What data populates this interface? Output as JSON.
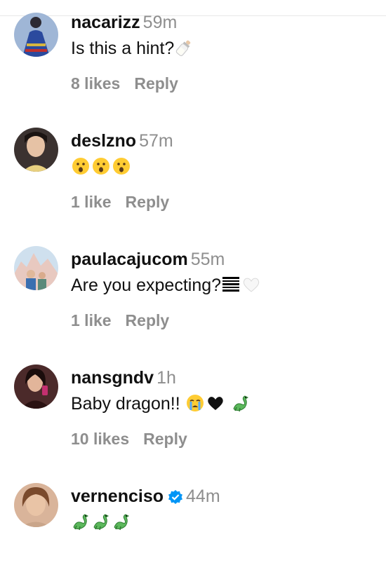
{
  "comments": [
    {
      "username": "nacarizz",
      "time": "59m",
      "text": "Is this a hint?",
      "text_emoji": [
        "baby-bottle"
      ],
      "likes": "8 likes",
      "reply": "Reply",
      "verified": false
    },
    {
      "username": "deslzno",
      "time": "57m",
      "text": "",
      "text_emoji": [
        "astonished-face",
        "astonished-face",
        "astonished-face"
      ],
      "likes": "1 like",
      "reply": "Reply",
      "verified": false
    },
    {
      "username": "paulacajucom",
      "time": "55m",
      "text": "Are you expecting?",
      "text_emoji": [
        "barcode",
        "white-heart"
      ],
      "likes": "1 like",
      "reply": "Reply",
      "verified": false
    },
    {
      "username": "nansgndv",
      "time": "1h",
      "text": "Baby dragon!!",
      "text_emoji": [
        "crying-face",
        "black-heart",
        "dragon"
      ],
      "likes": "10 likes",
      "reply": "Reply",
      "verified": false
    },
    {
      "username": "vernenciso",
      "time": "44m",
      "text": "",
      "text_emoji": [
        "dragon",
        "dragon",
        "dragon"
      ],
      "likes": "",
      "reply": "",
      "verified": true
    }
  ],
  "colors": {
    "username": "#111111",
    "meta": "#8e8e8e",
    "verified": "#0095f6"
  }
}
